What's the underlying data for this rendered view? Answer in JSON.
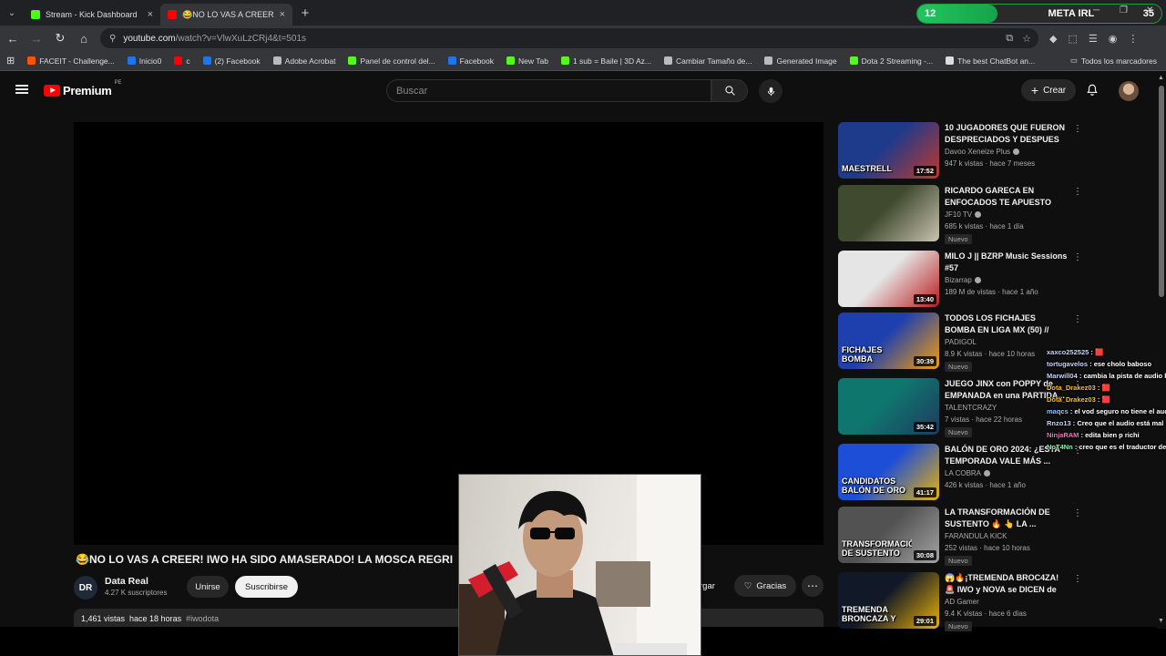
{
  "browser": {
    "tabs": [
      {
        "title": "Stream - Kick Dashboard",
        "color": "#53fc18",
        "active": false
      },
      {
        "title": "😂NO LO VAS A CREER! IW",
        "color": "#ff0000",
        "active": true
      }
    ],
    "meta_widget": {
      "left": "12",
      "title": "META IRL",
      "right": "35",
      "progress": 0.33
    },
    "url_host": "youtube.com",
    "url_path": "/watch?v=VlwXuLzCRj4&t=501s",
    "bookmarks": [
      {
        "label": "FACEIT - Challenge...",
        "color": "#ff5500"
      },
      {
        "label": "Inicio0",
        "color": "#1877f2"
      },
      {
        "label": "c",
        "color": "#ff0000"
      },
      {
        "label": "(2) Facebook",
        "color": "#1877f2"
      },
      {
        "label": "Adobe Acrobat",
        "color": "#bbbbbb"
      },
      {
        "label": "Panel de control del...",
        "color": "#53fc18"
      },
      {
        "label": "Facebook",
        "color": "#1877f2"
      },
      {
        "label": "New Tab",
        "color": "#53fc18"
      },
      {
        "label": "1 sub = Baile | 3D Az...",
        "color": "#53fc18"
      },
      {
        "label": "Cambiar Tamaño de...",
        "color": "#bbbbbb"
      },
      {
        "label": "Generated Image",
        "color": "#bbbbbb"
      },
      {
        "label": "Dota 2 Streaming -...",
        "color": "#53fc18"
      },
      {
        "label": "The best ChatBot an...",
        "color": "#dddddd"
      }
    ],
    "all_bookmarks": "Todos los marcadores"
  },
  "youtube": {
    "logo_word": "Premium",
    "country": "PE",
    "search_placeholder": "Buscar",
    "create_label": "Crear",
    "video": {
      "title": "😂NO LO VAS A CREER! IWO HA SIDO AMASERADO! LA MOSCA REGRI",
      "channel_initials": "DR",
      "channel_name": "Data Real",
      "subscribers": "4.27 K suscriptores",
      "join_label": "Unirse",
      "subscribe_label": "Suscribirse",
      "download_label": "rgar",
      "thanks_label": "Gracias",
      "views": "1,461 vistas",
      "date": "hace 18 horas",
      "hashtag": "#iwodota"
    },
    "recommendations": [
      {
        "title": "10 JUGADORES QUE FUERON DESPRECIADOS Y DESPUES S...",
        "channel": "Davoo Xeneize Plus",
        "verified": true,
        "views": "947 k vistas",
        "date": "hace 7 meses",
        "duration": "17:52",
        "new": "",
        "thumb": [
          "#1e3a8a",
          "#c0392b"
        ],
        "overlay": "MAESTRELL"
      },
      {
        "title": "RICARDO GARECA EN ENFOCADOS TE APUESTO CO...",
        "channel": "JF10 TV",
        "verified": true,
        "views": "685 k vistas",
        "date": "hace 1 día",
        "duration": "",
        "new": "Nuevo",
        "thumb": [
          "#3f4a2e",
          "#c9c3b0"
        ],
        "overlay": ""
      },
      {
        "title": "MILO J || BZRP Music Sessions #57",
        "channel": "Bizarrap",
        "verified": true,
        "views": "189 M de vistas",
        "date": "hace 1 año",
        "duration": "13:40",
        "new": "",
        "thumb": [
          "#e5e5e5",
          "#b91c1c"
        ],
        "overlay": ""
      },
      {
        "title": "TODOS LOS FICHAJES BOMBA EN LIGA MX (50) // SERGIO ...",
        "channel": "PADIGOL",
        "verified": false,
        "views": "8.9 K vistas",
        "date": "hace 10 horas",
        "duration": "30:39",
        "new": "Nuevo",
        "thumb": [
          "#1e40af",
          "#f59e0b"
        ],
        "overlay": "FICHAJES BOMBA"
      },
      {
        "title": "JUEGO JINX con POPPY de EMPANADA en una PARTIDA...",
        "channel": "TALENTCRAZY",
        "verified": false,
        "views": "7 vistas",
        "date": "hace 22 horas",
        "duration": "35:42",
        "new": "Nuevo",
        "thumb": [
          "#0f766e",
          "#1e3a5f"
        ],
        "overlay": ""
      },
      {
        "title": "BALÓN DE ORO 2024: ¿ESTA TEMPORADA VALE MÁS ...",
        "channel": "LA COBRA",
        "verified": true,
        "views": "426 k vistas",
        "date": "hace 1 año",
        "duration": "41:17",
        "new": "",
        "thumb": [
          "#1d4ed8",
          "#eab308"
        ],
        "overlay": "CANDIDATOS BALÓN DE ORO"
      },
      {
        "title": "LA TRANSFORMACIÓN DE SUSTENTO 🔥 👆 LA ...",
        "channel": "FARANDULA KICK",
        "verified": false,
        "views": "252 vistas",
        "date": "hace 10 horas",
        "duration": "30:08",
        "new": "Nuevo",
        "thumb": [
          "#525252",
          "#a3a3a3"
        ],
        "overlay": "TRANSFORMACIÓN DE SUSTENTO"
      },
      {
        "title": "😱🔥¡TREMENDA BROC4ZA!🚨 IWO y NOVA se DICEN de TOD...",
        "channel": "AD Gamer",
        "verified": false,
        "views": "9.4 K vistas",
        "date": "hace 6 días",
        "duration": "29:01",
        "new": "Nuevo",
        "thumb": [
          "#111827",
          "#eab308"
        ],
        "overlay": "TREMENDA BRONCAZA Y ESTA ESTA"
      }
    ]
  },
  "chat": [
    {
      "user": "xaxco252525",
      "text": "🟥",
      "cls": "u1"
    },
    {
      "user": "tortugavelos",
      "text": "ese cholo baboso",
      "cls": "u1"
    },
    {
      "user": "Marwill04",
      "text": "cambia la pista de audio br",
      "cls": "u1"
    },
    {
      "user": "Dota_Drakez03",
      "text": "🟥",
      "cls": "u2"
    },
    {
      "user": "Dota_Drakez03",
      "text": "🟥",
      "cls": "u2"
    },
    {
      "user": "maqcs",
      "text": "el vod seguro no tiene el audio",
      "cls": "u3"
    },
    {
      "user": "Rnzo13",
      "text": "Creo que el audio está mal",
      "cls": "u1"
    },
    {
      "user": "NinjaRAM",
      "text": "edita bien p richi",
      "cls": "u4"
    },
    {
      "user": "NoT4Nn",
      "text": "creo que es el traductor de",
      "cls": "u5"
    }
  ]
}
